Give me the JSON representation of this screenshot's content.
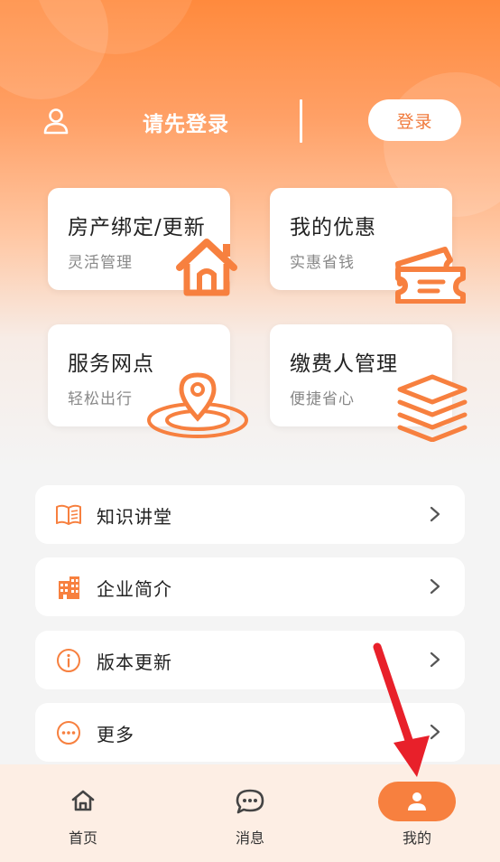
{
  "user": {
    "login_prompt": "请先登录",
    "login_button": "登录"
  },
  "cards": [
    {
      "title": "房产绑定/更新",
      "subtitle": "灵活管理",
      "icon": "house-icon"
    },
    {
      "title": "我的优惠",
      "subtitle": "实惠省钱",
      "icon": "ticket-icon"
    },
    {
      "title": "服务网点",
      "subtitle": "轻松出行",
      "icon": "location-pin-icon"
    },
    {
      "title": "缴费人管理",
      "subtitle": "便捷省心",
      "icon": "stack-layers-icon"
    }
  ],
  "menu": [
    {
      "label": "知识讲堂",
      "icon": "book-icon"
    },
    {
      "label": "企业简介",
      "icon": "building-icon"
    },
    {
      "label": "版本更新",
      "icon": "info-icon"
    },
    {
      "label": "更多",
      "icon": "more-dots-icon"
    }
  ],
  "tabbar": {
    "items": [
      {
        "label": "首页",
        "icon": "home-icon",
        "active": false
      },
      {
        "label": "消息",
        "icon": "chat-bubble-icon",
        "active": false
      },
      {
        "label": "我的",
        "icon": "user-icon",
        "active": true
      }
    ]
  },
  "colors": {
    "accent": "#f7803f",
    "header_top": "#ff8a3d",
    "background": "#f4f4f4",
    "tabbar_bg": "#fdeee4",
    "annotation_arrow": "#e8202a"
  }
}
